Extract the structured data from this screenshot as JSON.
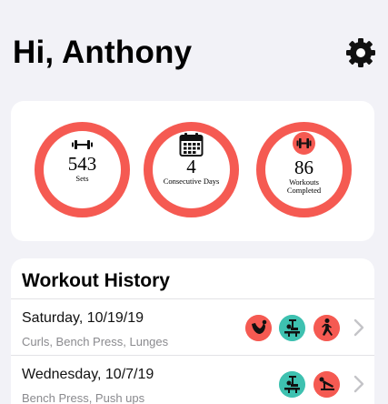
{
  "header": {
    "greeting": "Hi, Anthony",
    "settings_icon": "gear-icon"
  },
  "stats": [
    {
      "icon": "dumbbell-icon",
      "value": "543",
      "label_lines": [
        "Sets"
      ]
    },
    {
      "icon": "calendar-icon",
      "value": "4",
      "label_lines": [
        "Consecutive Days"
      ]
    },
    {
      "icon": "dumbbell-badge-icon",
      "value": "86",
      "label_lines": [
        "Workouts",
        "Completed"
      ]
    }
  ],
  "history": {
    "title": "Workout History",
    "rows": [
      {
        "date": "Saturday, 10/19/19",
        "exercises": "Curls, Bench Press, Lunges",
        "icons": [
          "arm-curl-icon",
          "bench-press-icon",
          "lunge-icon"
        ]
      },
      {
        "date": "Wednesday, 10/7/19",
        "exercises": "Bench Press, Push ups",
        "icons": [
          "bench-press-icon",
          "push-up-icon"
        ]
      }
    ]
  },
  "colors": {
    "accent": "#f55a52",
    "teal": "#3ec1b0",
    "background": "#f2f2f7",
    "card": "#ffffff"
  }
}
